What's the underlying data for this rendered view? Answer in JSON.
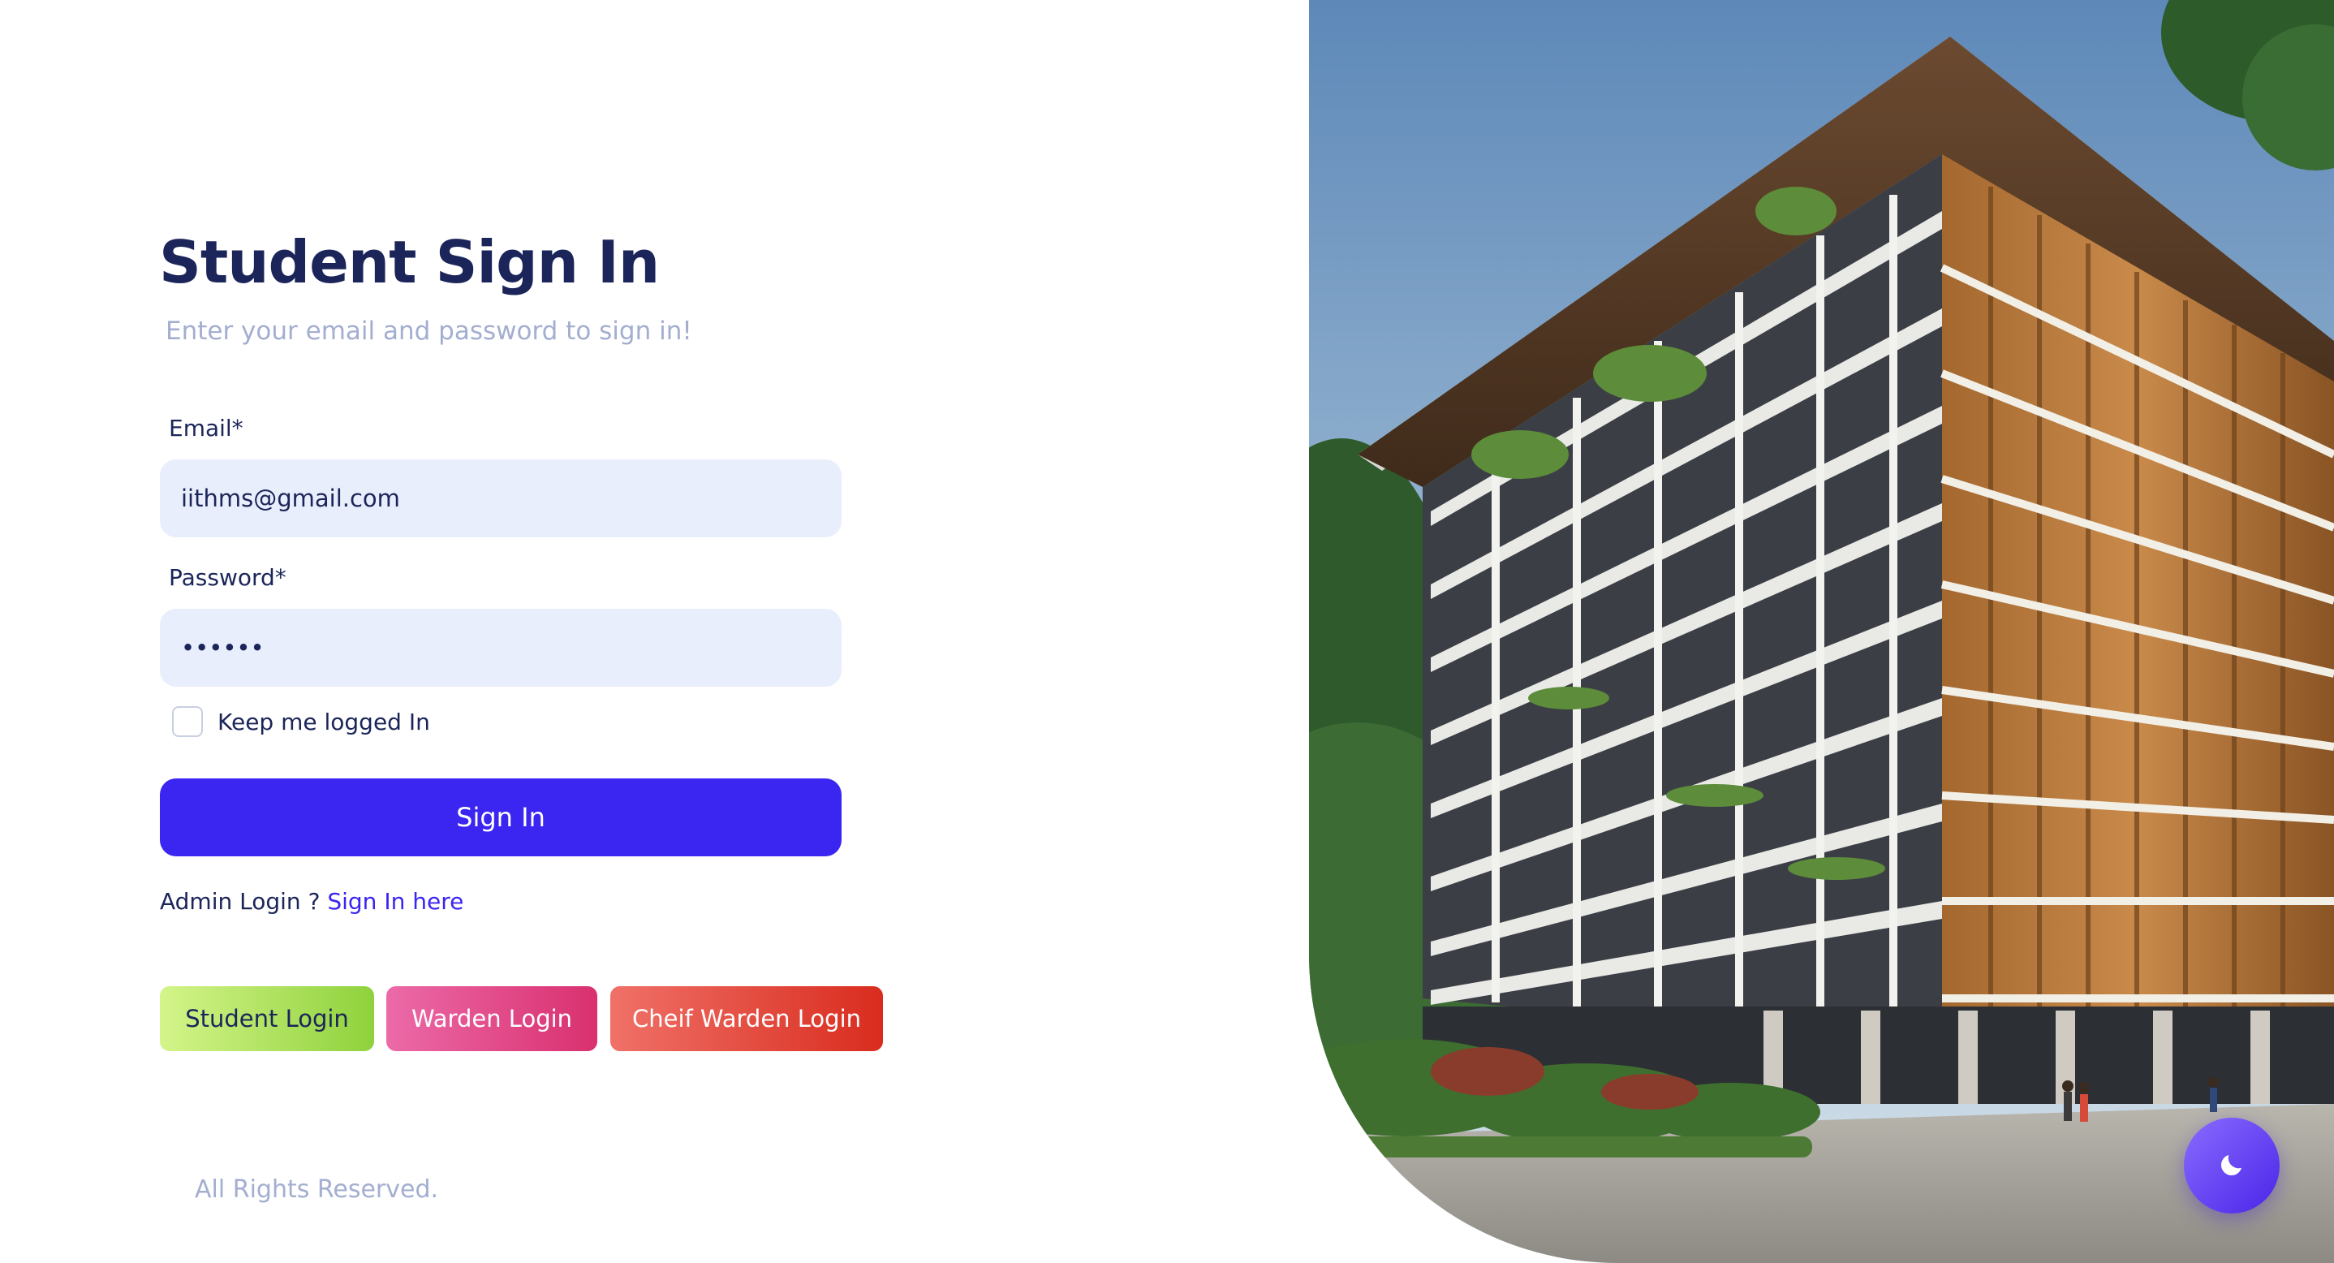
{
  "title": "Student Sign In",
  "subtitle": "Enter your email and password to sign in!",
  "form": {
    "email_label": "Email*",
    "email_value": "iithms@gmail.com",
    "password_label": "Password*",
    "password_value": "••••••",
    "keep_logged_in_label": "Keep me logged In",
    "keep_logged_in_checked": false,
    "submit_label": "Sign In"
  },
  "admin": {
    "prompt": "Admin Login ?",
    "link_label": "Sign In here"
  },
  "role_buttons": {
    "student": "Student Login",
    "warden": "Warden Login",
    "chief_warden": "Cheif Warden Login"
  },
  "footer": "All Rights Reserved.",
  "theme_toggle_icon": "moon-icon",
  "hero_image": "hostel-building-photo",
  "colors": {
    "primary": "#3b25f0",
    "title": "#1b2559",
    "muted": "#a3aed0",
    "input_bg": "#e8eefb"
  }
}
